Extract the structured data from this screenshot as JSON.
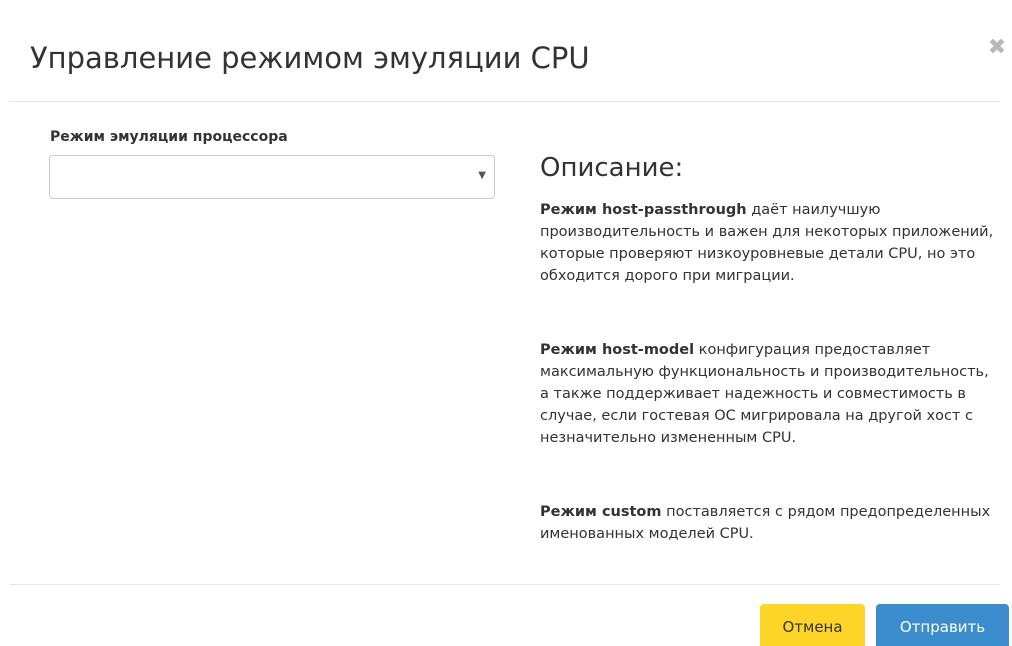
{
  "modal": {
    "title": "Управление режимом эмуляции CPU",
    "close_symbol": "✖"
  },
  "form": {
    "label": "Режим эмуляции процессора",
    "select_value": "",
    "caret": "▼"
  },
  "description": {
    "heading": "Описание:",
    "paragraphs": [
      {
        "bold": "Режим host-passthrough",
        "text": " даёт наилучшую производительность и важен для некоторых приложений, которые проверяют низкоуровневые детали CPU, но это обходится дорого при миграции."
      },
      {
        "bold": "Режим host-model",
        "text": " конфигурация предоставляет максимальную функциональность и производительность, а также поддерживает надежность и совместимость в случае, если гостевая ОС мигрировала на другой хост с незначительно измененным CPU."
      },
      {
        "bold": "Режим custom",
        "text": " поставляется с рядом предопределенных именованных моделей CPU."
      }
    ]
  },
  "footer": {
    "cancel_label": "Отмена",
    "submit_label": "Отправить"
  },
  "colors": {
    "cancel_button": "#fcd526",
    "submit_button": "#3c8dce"
  }
}
